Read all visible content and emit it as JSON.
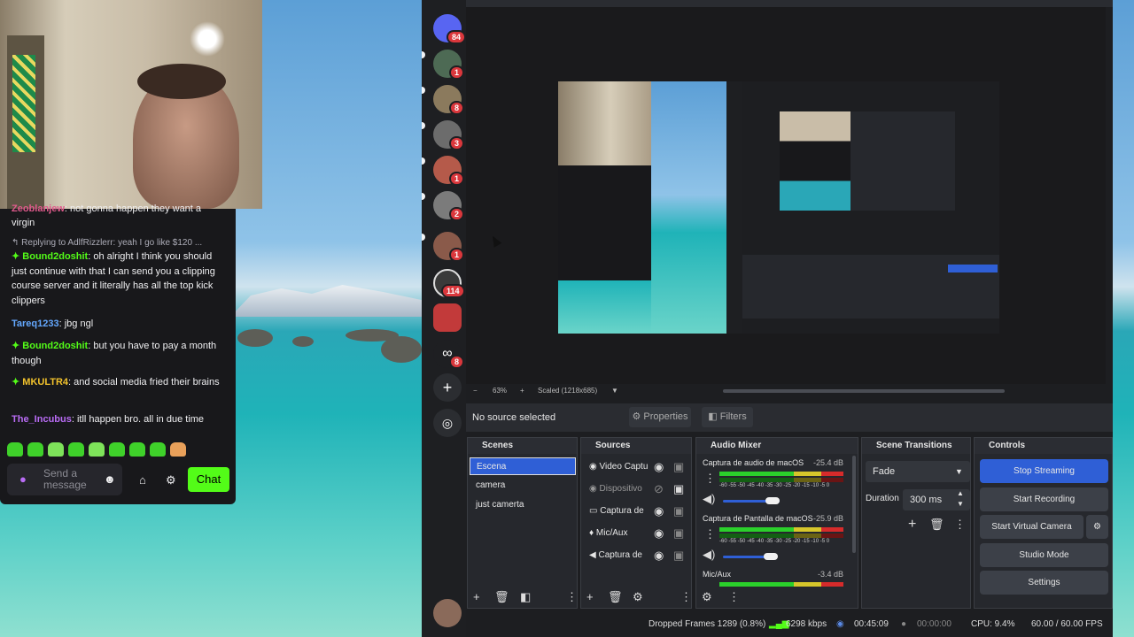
{
  "chat": {
    "partial_top": {
      "user": "Zeoblanjew",
      "text": ": not gonna happen they want a"
    },
    "partial_cont": "virgin",
    "reply_note": "↰ Replying to AdlfRizzlerr: yeah I go like $120 ...",
    "messages": [
      {
        "user": "Bound2doshit",
        "text": ": oh alright I think you should just continue with that I can send you a clipping course server and it literally has all the top kick clippers",
        "color": "#53fc18"
      },
      {
        "user": "Tareq1233",
        "text": ": jbg ngl",
        "color": "#64a8ff"
      },
      {
        "user": "Bound2doshit",
        "text": ": but you have to pay a month though",
        "color": "#53fc18"
      },
      {
        "user": "MKULTR4",
        "text": ": and social media fried their brains",
        "color": "#f2c22c"
      },
      {
        "user": "The_Incubus",
        "text": ": itll happen bro. all in due time",
        "color": "#b96cf5"
      }
    ],
    "input_placeholder": "Send a message",
    "chat_button": "Chat"
  },
  "discord": {
    "badges": [
      "84",
      "1",
      "8",
      "3",
      "1",
      "2",
      "1",
      "114",
      "8"
    ]
  },
  "obs": {
    "zoom": {
      "minus": "−",
      "value": "63%",
      "plus": "+",
      "scaled": "Scaled (1218x685)"
    },
    "no_source": "No source selected",
    "properties_button": "Properties",
    "filters_button": "Filters",
    "scenes": {
      "title": "Scenes",
      "items": [
        "Escena",
        "camera",
        "just camerta"
      ]
    },
    "sources": {
      "title": "Sources",
      "items": [
        "Video Captu",
        "Dispositivo",
        "Captura de",
        "Mic/Aux",
        "Captura de"
      ]
    },
    "mixer": {
      "title": "Audio Mixer",
      "channels": [
        {
          "name": "Captura de audio de macOS",
          "db": "-25.4 dB"
        },
        {
          "name": "Captura de Pantalla de macOS",
          "db": "-25.9 dB"
        },
        {
          "name": "Mic/Aux",
          "db": "-3.4 dB"
        }
      ],
      "scale": "-60 -55 -50 -45 -40 -35 -30 -25 -20 -15 -10 -5 0"
    },
    "transitions": {
      "title": "Scene Transitions",
      "type": "Fade",
      "duration_label": "Duration",
      "duration": "300 ms"
    },
    "controls": {
      "title": "Controls",
      "stop_streaming": "Stop Streaming",
      "start_recording": "Start Recording",
      "start_virtual_camera": "Start Virtual Camera",
      "studio_mode": "Studio Mode",
      "settings": "Settings"
    },
    "status": {
      "dropped": "Dropped Frames 1289 (0.8%)",
      "bitrate": "6298 kbps",
      "stream_time": "00:45:09",
      "rec_time": "00:00:00",
      "cpu": "CPU: 9.4%",
      "fps": "60.00 / 60.00 FPS"
    },
    "colors": {
      "accent": "#2f5fd6",
      "live": "#53fc18"
    }
  }
}
